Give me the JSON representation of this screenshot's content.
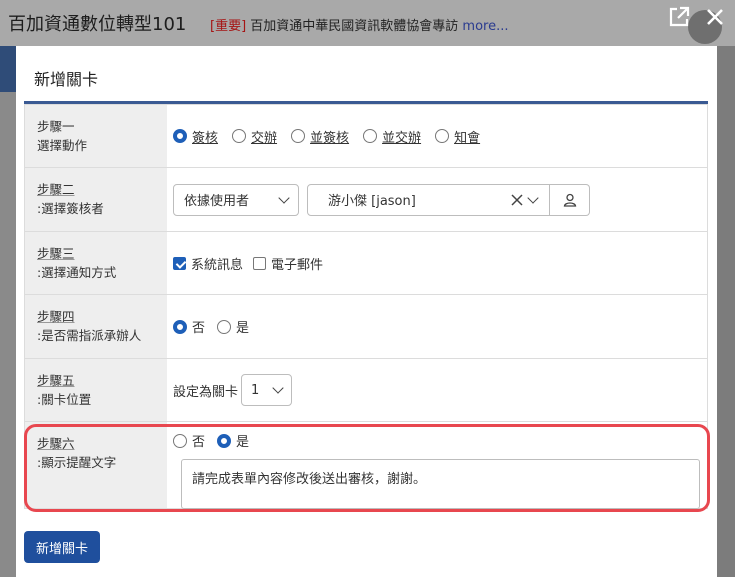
{
  "background": {
    "app_title": "百加資通數位轉型101",
    "notice_tag": "[重要]",
    "notice_text": " 百加資通中華民國資訊軟體協會專訪 ",
    "notice_more": "more..."
  },
  "modal": {
    "title": "新增關卡",
    "steps": {
      "s1": {
        "step": "步驟一",
        "desc": "選擇動作",
        "options": [
          "簽核",
          "交辦",
          "並簽核",
          "並交辦",
          "知會"
        ],
        "selected": "簽核"
      },
      "s2": {
        "step": "步驟二",
        "desc": ":選擇簽核者",
        "mode_select": "依據使用者",
        "user_value": "游小傑 [jason]"
      },
      "s3": {
        "step": "步驟三",
        "desc": ":選擇通知方式",
        "options": [
          "系統訊息",
          "電子郵件"
        ],
        "checked": [
          "系統訊息"
        ]
      },
      "s4": {
        "step": "步驟四",
        "desc": ":是否需指派承辦人",
        "options": [
          "否",
          "是"
        ],
        "selected": "否"
      },
      "s5": {
        "step": "步驟五",
        "desc": ":關卡位置",
        "label": "設定為關卡",
        "position": "1"
      },
      "s6": {
        "step": "步驟六",
        "desc": ":顯示提醒文字",
        "options": [
          "否",
          "是"
        ],
        "selected": "是",
        "text": "請完成表單內容修改後送出審核，謝謝。"
      }
    },
    "submit_label": "新增關卡"
  },
  "colors": {
    "accent": "#1e5fb8",
    "header_rule": "#3a5a93",
    "highlight": "#e8474f",
    "submit_bg": "#1f4f9d"
  }
}
